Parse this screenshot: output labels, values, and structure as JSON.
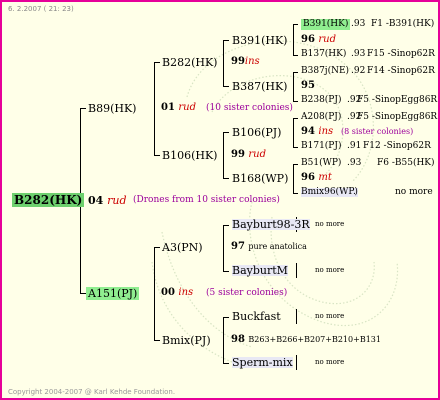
{
  "header": "6. 2.2007 ( 21: 23)",
  "footer": "Copyright 2004-2007 @ Karl Kehde Foundation.",
  "root": {
    "name": "B282(HK)",
    "gen": "04",
    "race": "rud",
    "note": "(Drones from 10 sister colonies)"
  },
  "sire": {
    "name": "B89(HK)",
    "gen": "01",
    "race": "rud",
    "note": "(10 sister colonies)"
  },
  "dam": {
    "name": "A151(PJ)",
    "gen": "00",
    "race": "ins",
    "note": "(5 sister colonies)"
  },
  "ss": {
    "name": "B282(HK)",
    "gen": "99",
    "race": "ins"
  },
  "sd": {
    "name": "B106(HK)",
    "gen": "99",
    "race": "rud"
  },
  "ds": {
    "name": "A3(PN)",
    "gen": "97",
    "race": "pure anatolica"
  },
  "dd": {
    "name": "Bmix(PJ)",
    "gen": "98",
    "race": "B263+B266+B207+B210+B131"
  },
  "sss": {
    "name": "B391(HK)",
    "gen": "96",
    "race": "rud"
  },
  "ssd": {
    "name": "B387(HK)",
    "gen": "95",
    "race": ""
  },
  "sds": {
    "name": "B106(PJ)",
    "gen": "94",
    "race": "ins",
    "note": "(8 sister colonies)"
  },
  "sdd": {
    "name": "B168(WP)",
    "gen": "96",
    "race": "mt"
  },
  "dss": {
    "name": "Bayburt98-3R"
  },
  "dsd": {
    "name": "BayburtM"
  },
  "dds": {
    "name": "Buckfast"
  },
  "ddd": {
    "name": "Sperm-mix"
  },
  "nomore": "no more",
  "g4": [
    {
      "name": "B391(HK)",
      "year": ".93",
      "info": "F1 -B391(HK)"
    },
    {
      "name": "B137(HK)",
      "year": ".93",
      "info": "F15 -Sinop62R"
    },
    {
      "name": "B387j(NE)",
      "year": ".92",
      "info": "F14 -Sinop62R"
    },
    {
      "name": "B238(PJ)",
      "year": ".92",
      "info": "F5 -SinopEgg86R"
    },
    {
      "name": "A208(PJ)",
      "year": ".92",
      "info": "F5 -SinopEgg86R"
    },
    {
      "name": "B171(PJ)",
      "year": ".91",
      "info": "F12 -Sinop62R"
    },
    {
      "name": "B51(WP)",
      "year": ".93",
      "info": "F6 -B55(HK)"
    },
    {
      "name": "Bmix96(WP)",
      "year": ".",
      "info": "no more"
    }
  ]
}
